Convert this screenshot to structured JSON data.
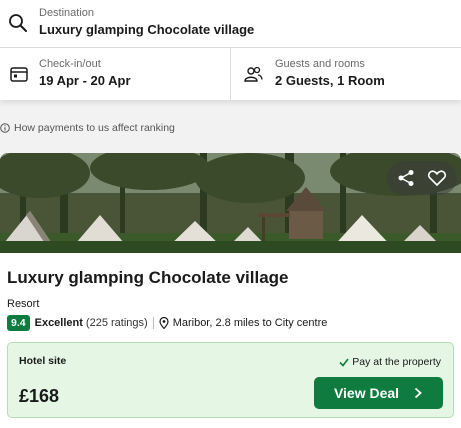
{
  "search": {
    "destination_label": "Destination",
    "destination_value": "Luxury glamping Chocolate village",
    "checkin_label": "Check-in/out",
    "checkin_value": "19 Apr - 20 Apr",
    "guests_label": "Guests and rooms",
    "guests_value": "2 Guests, 1 Room"
  },
  "ranking_note": "How payments to us affect ranking",
  "hotel": {
    "name": "Luxury glamping Chocolate village",
    "type": "Resort",
    "rating_score": "9.4",
    "rating_word": "Excellent",
    "rating_count": "(225 ratings)",
    "location": "Maribor, 2.8 miles to City centre"
  },
  "deal": {
    "site_label": "Hotel site",
    "pay_note": "Pay at the property",
    "price": "£168",
    "button_label": "View Deal"
  },
  "colors": {
    "brand_green": "#0f7b3e",
    "deal_background": "#e5f6e5"
  },
  "icons": [
    "search-icon",
    "calendar-icon",
    "guests-icon",
    "info-icon",
    "share-icon",
    "heart-icon",
    "location-pin-icon",
    "check-icon",
    "chevron-right-icon"
  ]
}
